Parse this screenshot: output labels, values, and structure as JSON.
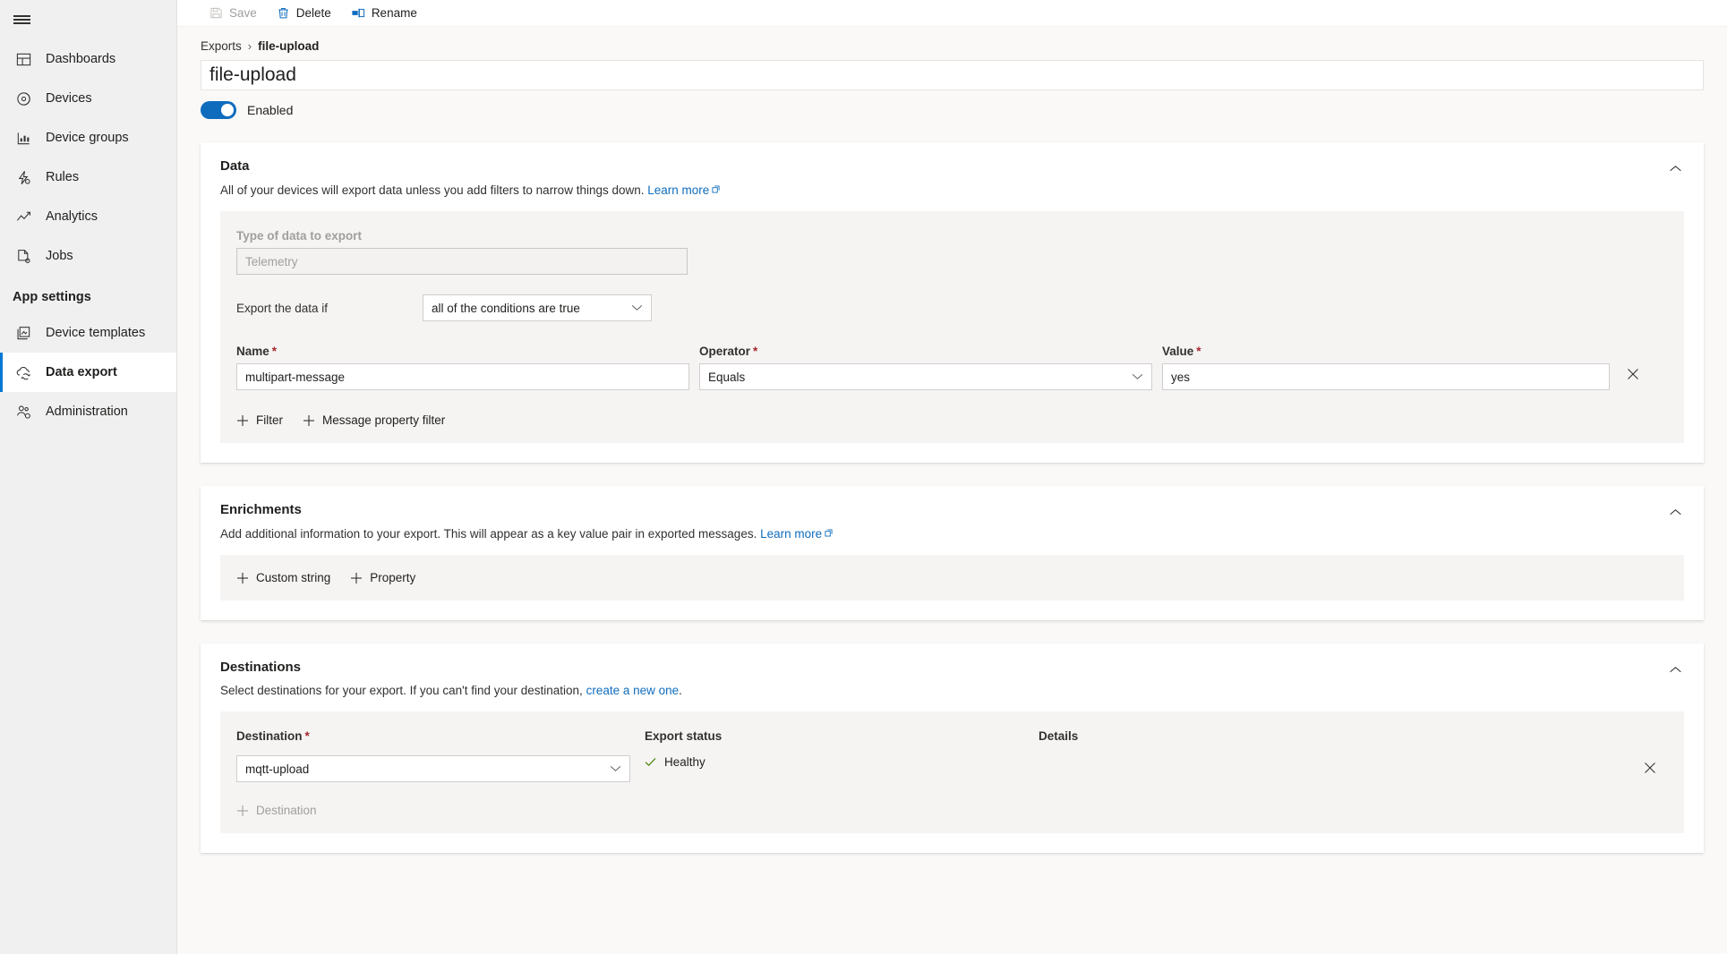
{
  "sidebar": {
    "menu_icon": "hamburger-icon",
    "items": [
      {
        "label": "Dashboards",
        "icon": "dashboard-icon",
        "selected": false
      },
      {
        "label": "Devices",
        "icon": "devices-icon",
        "selected": false
      },
      {
        "label": "Device groups",
        "icon": "device-groups-icon",
        "selected": false
      },
      {
        "label": "Rules",
        "icon": "rules-icon",
        "selected": false
      },
      {
        "label": "Analytics",
        "icon": "analytics-icon",
        "selected": false
      },
      {
        "label": "Jobs",
        "icon": "jobs-icon",
        "selected": false
      }
    ],
    "section_label": "App settings",
    "settings_items": [
      {
        "label": "Device templates",
        "icon": "device-templates-icon",
        "selected": false
      },
      {
        "label": "Data export",
        "icon": "data-export-icon",
        "selected": true
      },
      {
        "label": "Administration",
        "icon": "administration-icon",
        "selected": false
      }
    ],
    "accent": "#0078d4"
  },
  "toolbar": {
    "save_label": "Save",
    "save_disabled": true,
    "delete_label": "Delete",
    "rename_label": "Rename"
  },
  "breadcrumb": {
    "parent": "Exports",
    "separator": "›",
    "current": "file-upload"
  },
  "header": {
    "name_value": "file-upload",
    "name_placeholder": "Enter a name",
    "enabled_label": "Enabled",
    "enabled": true
  },
  "data_section": {
    "title": "Data",
    "description": "All of your devices will export data unless you add filters to narrow things down.",
    "learn_more": "Learn more",
    "type_label": "Type of data to export",
    "type_value": "Telemetry",
    "condition_label": "Export the data if",
    "condition_value": "all of the conditions are true",
    "columns": {
      "name": "Name",
      "operator": "Operator",
      "value": "Value"
    },
    "filter": {
      "name": "multipart-message",
      "operator": "Equals",
      "value": "yes"
    },
    "add_filter": "Filter",
    "add_message_property_filter": "Message property filter"
  },
  "enrichments_section": {
    "title": "Enrichments",
    "description": "Add additional information to your export. This will appear as a key value pair in exported messages.",
    "learn_more": "Learn more",
    "add_custom_string": "Custom string",
    "add_property": "Property"
  },
  "destinations_section": {
    "title": "Destinations",
    "description_pre": "Select destinations for your export. If you can't find your destination,",
    "create_link": "create a new one",
    "description_post": ".",
    "columns": {
      "destination": "Destination",
      "export_status": "Export status",
      "details": "Details"
    },
    "destination_value": "mqtt-upload",
    "status_value": "Healthy",
    "details_value": "",
    "add_destination": "Destination",
    "add_destination_disabled": true
  },
  "colors": {
    "accent": "#0f6cbd",
    "link": "#0f6cbd",
    "required": "#a4262c",
    "healthy": "#498205",
    "sidebar_bg": "#f0f0f0",
    "page_bg": "#faf9f8",
    "card_bg": "#ffffff",
    "inner_bg": "#f5f4f3"
  }
}
